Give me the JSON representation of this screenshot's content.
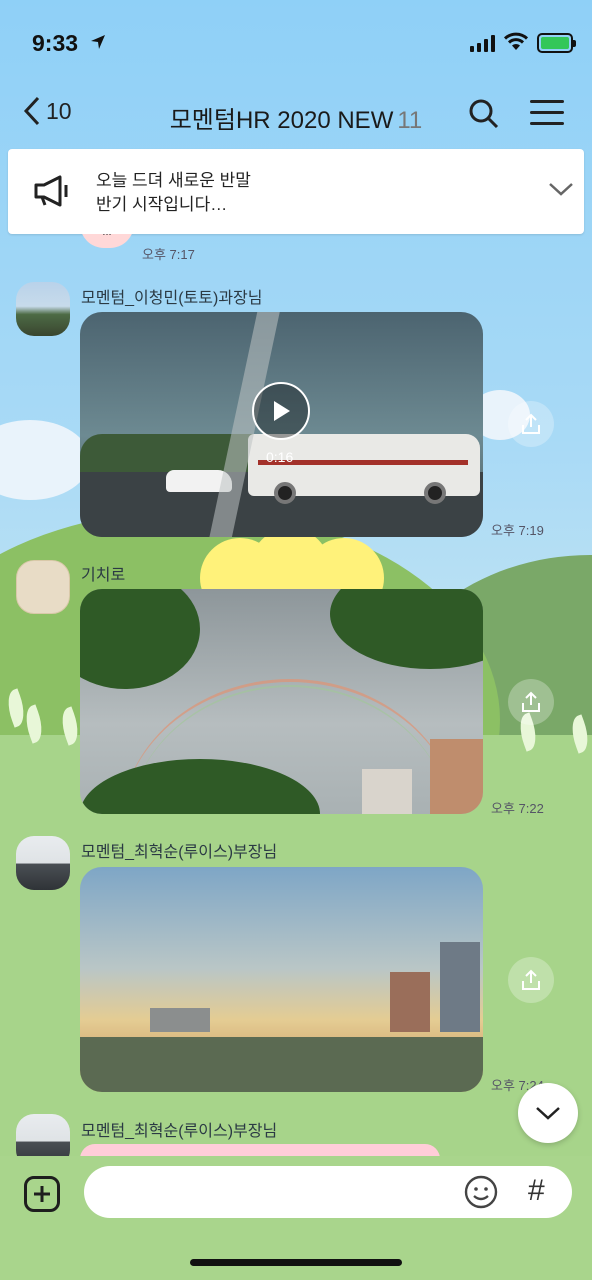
{
  "status": {
    "time": "9:33"
  },
  "header": {
    "back_count": "10",
    "title": "모멘텀HR 2020 NEW",
    "member_count": "11"
  },
  "notice": {
    "line1": "오늘 드뎌 새로운 반말",
    "line2": "반기 시작입니다…"
  },
  "messages": [
    {
      "time": "오후 7:17",
      "prev_avatar_text": "!!!"
    },
    {
      "sender": "모멘텀_이청민(토토)과장님",
      "type": "video",
      "duration": "0:16",
      "time": "오후 7:19"
    },
    {
      "sender": "기치로",
      "type": "photo",
      "time": "오후 7:22"
    },
    {
      "sender": "모멘텀_최혁순(루이스)부장님",
      "type": "photo",
      "time": "오후 7:24"
    },
    {
      "sender": "모멘텀_최혁순(루이스)부장님"
    }
  ],
  "input": {
    "placeholder": "",
    "hash_symbol": "#"
  },
  "colors": {
    "wallpaper_sky": "#9fd3f5",
    "wallpaper_grass": "#a7d48a",
    "battery": "#33c759"
  },
  "icons": [
    "location-arrow-icon",
    "signal-icon",
    "wifi-icon",
    "battery-icon",
    "back-chevron-icon",
    "search-icon",
    "menu-icon",
    "megaphone-icon",
    "chevron-down-icon",
    "play-icon",
    "share-icon",
    "plus-icon",
    "emoji-icon",
    "hash-icon"
  ]
}
